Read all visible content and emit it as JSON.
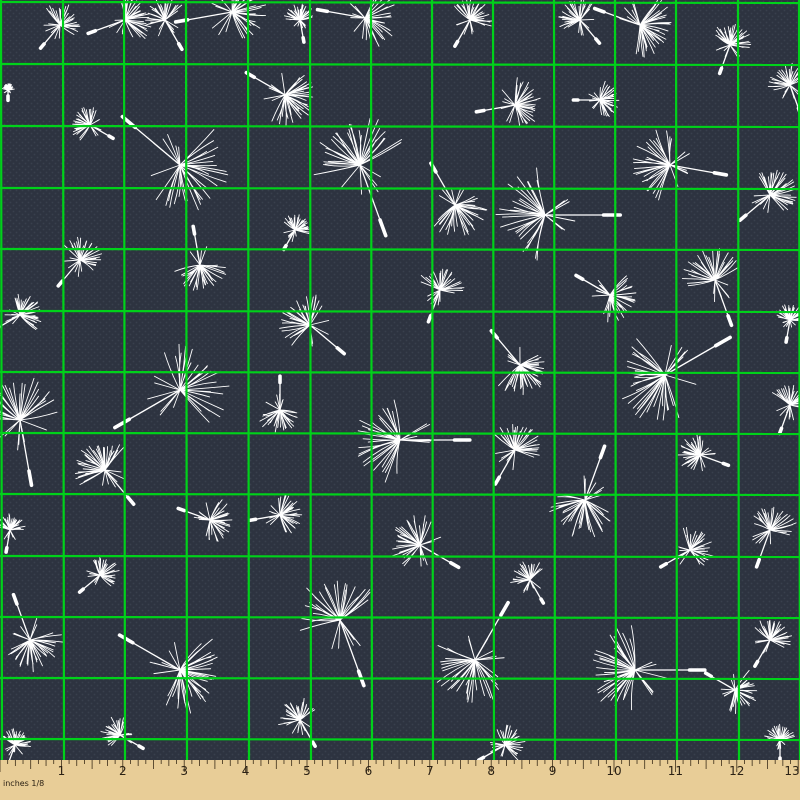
{
  "colors": {
    "fabric_background": "#2d3340",
    "fabric_texture_dot": "#39404d",
    "seed": "#ffffff",
    "grid": "#00d21a",
    "ruler": "#e8cd97",
    "ruler_tick": "#3b2d18"
  },
  "pattern": {
    "motif_name": "dandelion-seed",
    "icon": "dandelion-seed-icon"
  },
  "ruler": {
    "unit_label": "inches 1/8",
    "numbers": [
      "1",
      "2",
      "3",
      "4",
      "5",
      "6",
      "7",
      "8",
      "9",
      "10",
      "11",
      "12",
      "13"
    ]
  }
}
